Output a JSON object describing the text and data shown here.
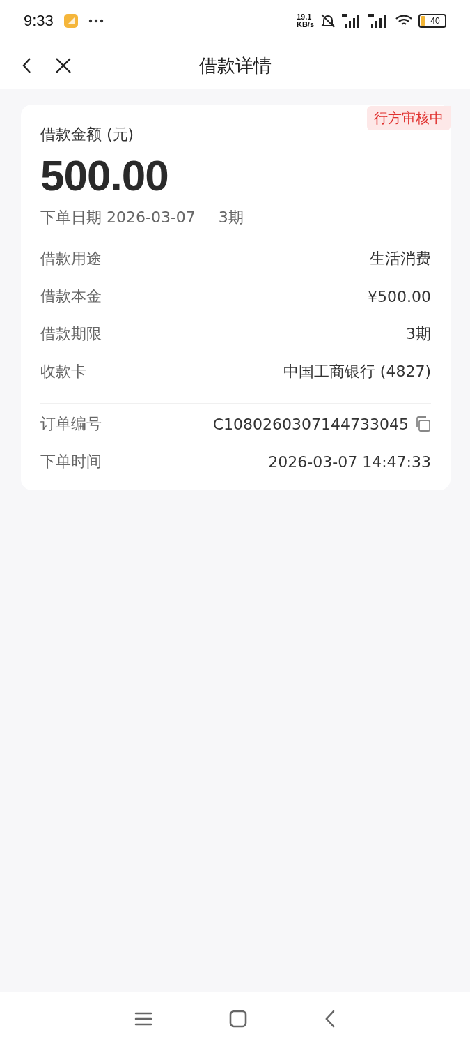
{
  "status_bar": {
    "time": "9:33",
    "speed_value": "19.1",
    "speed_unit": "KB/s",
    "battery": "40"
  },
  "nav": {
    "title": "借款详情"
  },
  "card": {
    "status_tag": "行方审核中",
    "amount_label": "借款金额 (元)",
    "amount": "500.00",
    "order_date_label": "下单日期",
    "order_date": "2026-03-07",
    "term": "3期",
    "details": [
      {
        "label": "借款用途",
        "value": "生活消费"
      },
      {
        "label": "借款本金",
        "value": "¥500.00"
      },
      {
        "label": "借款期限",
        "value": "3期"
      },
      {
        "label": "收款卡",
        "value": "中国工商银行 (4827)"
      }
    ],
    "order_info": [
      {
        "label": "订单编号",
        "value": "C1080260307144733045",
        "copyable": true
      },
      {
        "label": "下单时间",
        "value": "2026-03-07 14:47:33",
        "copyable": false
      }
    ]
  }
}
